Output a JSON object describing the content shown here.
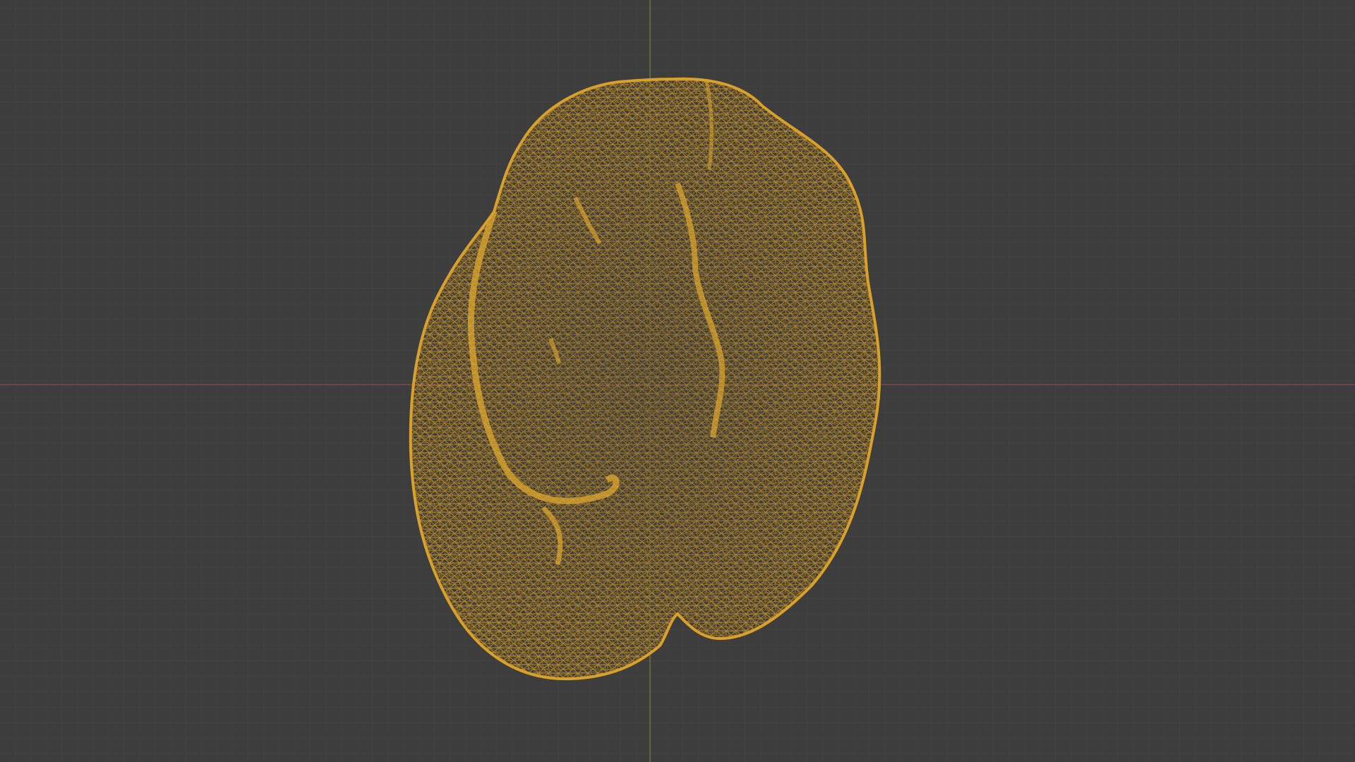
{
  "viewport": {
    "background_color": "#3d3d3d",
    "grid_minor_color": "#474747",
    "grid_major_color": "#4d4d4d",
    "x_axis_color": "#9a4a4a",
    "y_axis_color": "#6f8a3c"
  },
  "object": {
    "icon": "wireframe-mesh-icon",
    "display_mode": "wireframe",
    "wire_color": "#d9a02a",
    "wire_color_dark": "#b8821c"
  }
}
